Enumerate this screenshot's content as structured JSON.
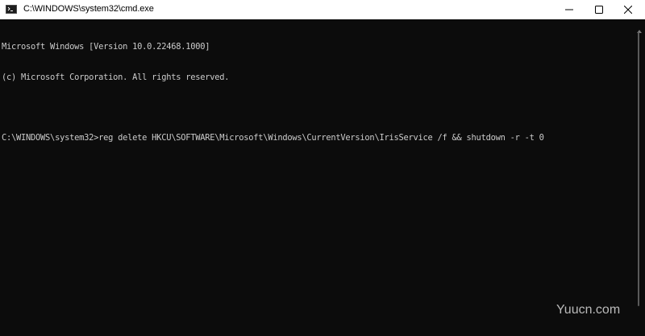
{
  "window": {
    "title": "C:\\WINDOWS\\system32\\cmd.exe",
    "app_icon": "cmd-icon"
  },
  "titlebar_buttons": {
    "minimize_icon": "minimize-icon",
    "maximize_icon": "maximize-icon",
    "close_icon": "close-icon"
  },
  "console": {
    "lines": [
      "Microsoft Windows [Version 10.0.22468.1000]",
      "(c) Microsoft Corporation. All rights reserved.",
      "",
      "C:\\WINDOWS\\system32>reg delete HKCU\\SOFTWARE\\Microsoft\\Windows\\CurrentVersion\\IrisService /f && shutdown -r -t 0"
    ],
    "background": "#0c0c0c",
    "foreground": "#cccccc"
  },
  "watermark": {
    "text": "Yuucn.com"
  }
}
